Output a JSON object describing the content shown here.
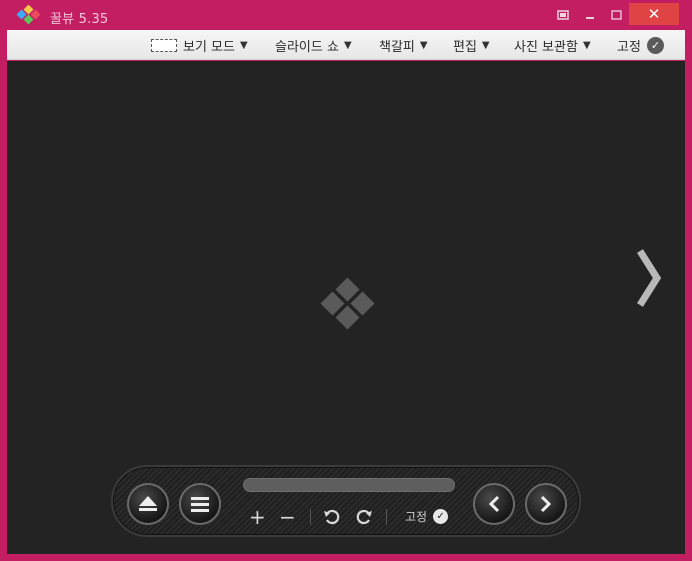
{
  "window": {
    "title": "꿀뷰 5.35",
    "close_symbol": "✕"
  },
  "menubar": {
    "items": [
      {
        "label": "보기 모드",
        "icon": "view-mode-icon"
      },
      {
        "label": "슬라이드 쇼"
      },
      {
        "label": "책갈피"
      },
      {
        "label": "편집"
      },
      {
        "label": "사진 보관함"
      }
    ],
    "pin_label": "고정"
  },
  "controls": {
    "zoom_in": "+",
    "zoom_out": "−",
    "pin_label": "고정"
  },
  "colors": {
    "frame": "#c41e63",
    "canvas": "#232323",
    "menubar": "#f0f0f0",
    "close_button": "#e04343"
  }
}
